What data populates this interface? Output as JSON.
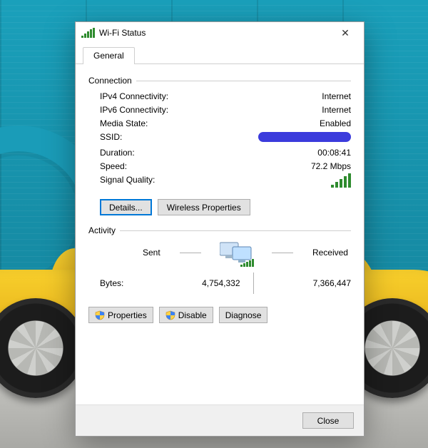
{
  "window": {
    "title": "Wi-Fi Status",
    "tab": "General",
    "close_x": "✕"
  },
  "connection": {
    "section": "Connection",
    "ipv4_label": "IPv4 Connectivity:",
    "ipv4_value": "Internet",
    "ipv6_label": "IPv6 Connectivity:",
    "ipv6_value": "Internet",
    "media_label": "Media State:",
    "media_value": "Enabled",
    "ssid_label": "SSID:",
    "ssid_value_redacted": true,
    "duration_label": "Duration:",
    "duration_value": "00:08:41",
    "speed_label": "Speed:",
    "speed_value": "72.2 Mbps",
    "signal_label": "Signal Quality:",
    "details_btn": "Details...",
    "wireless_btn": "Wireless Properties"
  },
  "activity": {
    "section": "Activity",
    "sent_label": "Sent",
    "received_label": "Received",
    "bytes_label": "Bytes:",
    "sent_value": "4,754,332",
    "received_value": "7,366,447"
  },
  "admin": {
    "properties_btn": "Properties",
    "disable_btn": "Disable",
    "diagnose_btn": "Diagnose"
  },
  "footer": {
    "close_btn": "Close"
  }
}
